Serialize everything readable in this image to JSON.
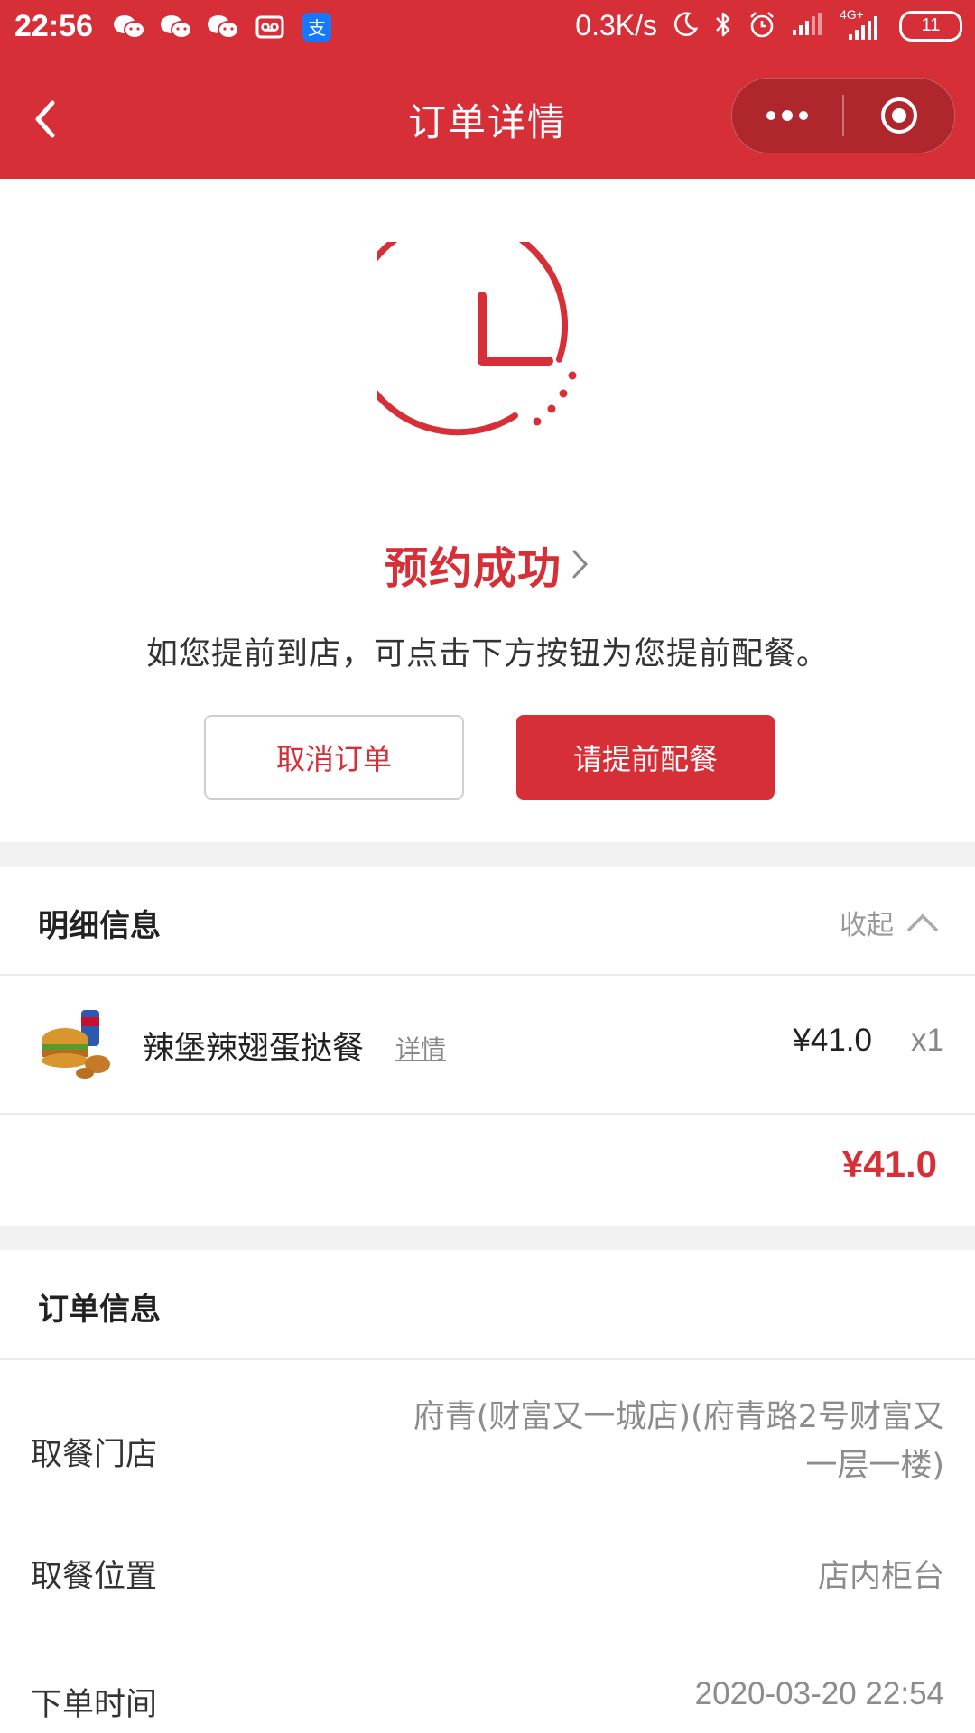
{
  "status_bar": {
    "time": "22:56",
    "network_speed": "0.3K/s",
    "network_type": "4G+",
    "battery": "11",
    "icons": [
      "wechat-icon",
      "wechat-icon",
      "wechat-icon",
      "voicemail-icon",
      "alipay-icon",
      "moon-icon",
      "bluetooth-icon",
      "alarm-icon",
      "signal-icon",
      "signal-4g-icon",
      "battery-icon"
    ]
  },
  "nav": {
    "title": "订单详情",
    "icons": [
      "back-icon",
      "more-icon",
      "close-miniapp-icon"
    ]
  },
  "hero": {
    "status_title": "预约成功",
    "hint": "如您提前到店，可点击下方按钮为您提前配餐。",
    "cancel_label": "取消订单",
    "prepare_label": "请提前配餐"
  },
  "details": {
    "title": "明细信息",
    "collapse_label": "收起",
    "items": [
      {
        "name": "辣堡辣翅蛋挞餐",
        "detail_link": "详情",
        "price": "¥41.0",
        "qty": "x1"
      }
    ],
    "total": "¥41.0"
  },
  "order_info": {
    "title": "订单信息",
    "rows": [
      {
        "label": "取餐门店",
        "value_line1": "府青(财富又一城店)(府青路2号财富又",
        "value_line2": "一层一楼)"
      },
      {
        "label": "取餐位置",
        "value": "店内柜台"
      },
      {
        "label": "下单时间",
        "value": "2020-03-20 22:54"
      }
    ]
  },
  "colors": {
    "brand_red": "#d72f38",
    "gray_text": "#8c8c8c",
    "divider": "#f2f2f2"
  }
}
